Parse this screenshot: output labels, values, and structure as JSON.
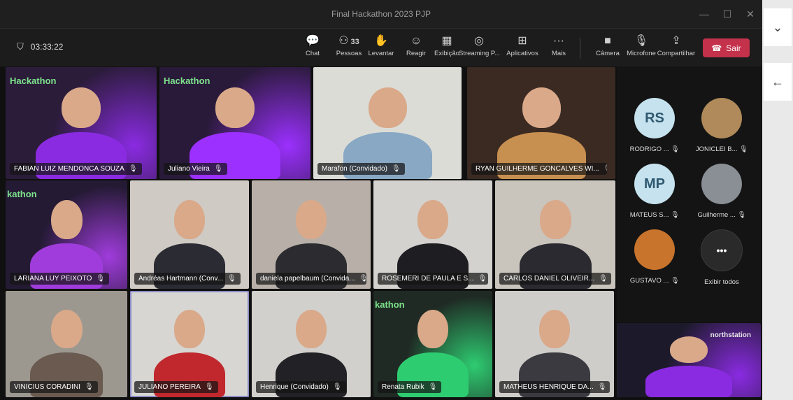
{
  "window": {
    "title": "Final Hackathon 2023 PJP"
  },
  "toolbar": {
    "timer": "03:33:22",
    "people_count": "33",
    "buttons": [
      {
        "label": "Chat",
        "icon": "chat-icon"
      },
      {
        "label": "Pessoas",
        "icon": "people-icon"
      },
      {
        "label": "Levantar",
        "icon": "raise-hand-icon"
      },
      {
        "label": "Reagir",
        "icon": "react-icon"
      },
      {
        "label": "Exibição",
        "icon": "view-icon"
      },
      {
        "label": "Streaming P...",
        "icon": "streaming-icon"
      },
      {
        "label": "Aplicativos",
        "icon": "apps-icon"
      },
      {
        "label": "Mais",
        "icon": "more-icon"
      },
      {
        "label": "Câmera",
        "icon": "camera-icon"
      },
      {
        "label": "Microfone",
        "icon": "mic-off-icon"
      },
      {
        "label": "Compartilhar",
        "icon": "share-icon"
      }
    ],
    "leave_label": "Sair"
  },
  "brand": {
    "hackathon": "Hackathon",
    "hackathon_cut": "kathon",
    "partner": "northstation"
  },
  "tiles": [
    {
      "name": "FABIAN LUIZ MENDONCA SOUZA",
      "bg": "#2b1c3a",
      "accent": "#8a2be2"
    },
    {
      "name": "Juliano Vieira",
      "bg": "#2a1a3a",
      "accent": "#9b30ff"
    },
    {
      "name": "Marafon (Convidado)",
      "bg": "#dcdcd6",
      "accent": "#88a8c4"
    },
    {
      "name": "RYAN GUILHERME GONCALVES WI...",
      "bg": "#3a2a22",
      "accent": "#c89050"
    },
    {
      "name": "LARIANA LUY PEIXOTO",
      "bg": "#241a34",
      "accent": "#a03cdc"
    },
    {
      "name": "Andréas Hartmann (Conv...",
      "bg": "#cfcac4",
      "accent": "#2b2b33"
    },
    {
      "name": "daniela papelbaum (Convida...",
      "bg": "#b8b0a8",
      "accent": "#2c2c30"
    },
    {
      "name": "ROSEMERI DE PAULA E S...",
      "bg": "#d4d2ce",
      "accent": "#1e1e22"
    },
    {
      "name": "CARLOS DANIEL OLIVEIR...",
      "bg": "#c9c4bc",
      "accent": "#2a2a30"
    },
    {
      "name": "VINICIUS CORADINI",
      "bg": "#9c9890",
      "accent": "#6a5a50"
    },
    {
      "name": "JULIANO PEREIRA",
      "bg": "#d8d6d2",
      "accent": "#c0282e"
    },
    {
      "name": "Henrique (Convidado)",
      "bg": "#d2d0cc",
      "accent": "#222226"
    },
    {
      "name": "Renata Rubik",
      "bg": "#1f2a24",
      "accent": "#2ecc71"
    },
    {
      "name": "MATHEUS HENRIQUE DA...",
      "bg": "#cfcdca",
      "accent": "#3a3a40"
    },
    {
      "name": "",
      "bg": "#1c1a2a",
      "accent": "#8a2be2"
    }
  ],
  "roster": [
    {
      "initials": "RS",
      "name": "RODRIGO ...",
      "color": "#c5e2ee"
    },
    {
      "initials": "",
      "name": "JONICLEI B...",
      "color": "#b08a5a"
    },
    {
      "initials": "MP",
      "name": "MATEUS S...",
      "color": "#c5e2ee"
    },
    {
      "initials": "",
      "name": "Guilherme ...",
      "color": "#8a8f95"
    },
    {
      "initials": "",
      "name": "GUSTAVO ...",
      "color": "#c8742c"
    },
    {
      "initials": "•••",
      "name": "Exibir todos",
      "color": "#2a2a2a"
    }
  ]
}
